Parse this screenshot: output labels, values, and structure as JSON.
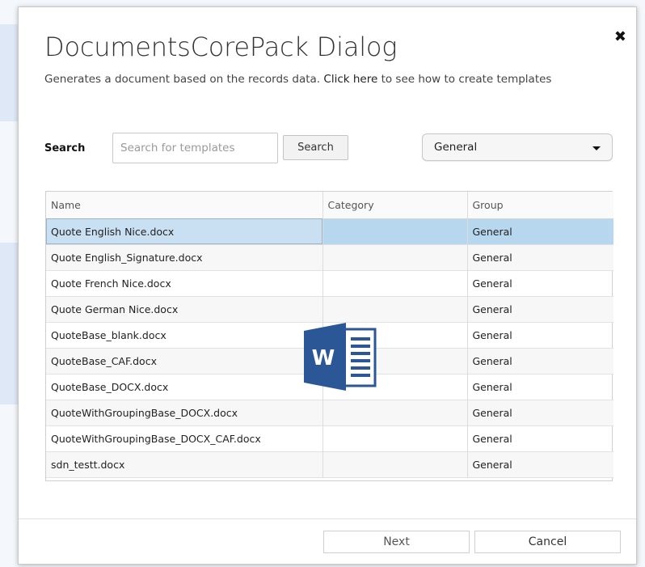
{
  "dialog": {
    "title": "DocumentsCorePack Dialog",
    "subtitle_prefix": "Generates a document based on the records data. ",
    "subtitle_link": "Click here",
    "subtitle_suffix": " to see how to create templates",
    "close_symbol": "✖"
  },
  "search": {
    "label": "Search",
    "placeholder": "Search for templates",
    "value": "",
    "button_label": "Search"
  },
  "group_filter": {
    "selected": "General"
  },
  "table": {
    "columns": [
      "Name",
      "Category",
      "Group"
    ],
    "rows": [
      {
        "name": "Quote English Nice.docx",
        "category": "",
        "group": "General",
        "selected": true
      },
      {
        "name": "Quote English_Signature.docx",
        "category": "",
        "group": "General"
      },
      {
        "name": "Quote French Nice.docx",
        "category": "",
        "group": "General"
      },
      {
        "name": "Quote German Nice.docx",
        "category": "",
        "group": "General"
      },
      {
        "name": "QuoteBase_blank.docx",
        "category": "",
        "group": "General"
      },
      {
        "name": "QuoteBase_CAF.docx",
        "category": "",
        "group": "General"
      },
      {
        "name": "QuoteBase_DOCX.docx",
        "category": "",
        "group": "General"
      },
      {
        "name": "QuoteWithGroupingBase_DOCX.docx",
        "category": "",
        "group": "General"
      },
      {
        "name": "QuoteWithGroupingBase_DOCX_CAF.docx",
        "category": "",
        "group": "General"
      },
      {
        "name": "sdn_testt.docx",
        "category": "",
        "group": "General"
      }
    ]
  },
  "word_icon": {
    "letter": "W",
    "color": "#2b5797"
  },
  "footer": {
    "next_label": "Next",
    "cancel_label": "Cancel"
  },
  "colors": {
    "selected_row": "#b7d7ef",
    "accent": "#2b5797"
  }
}
